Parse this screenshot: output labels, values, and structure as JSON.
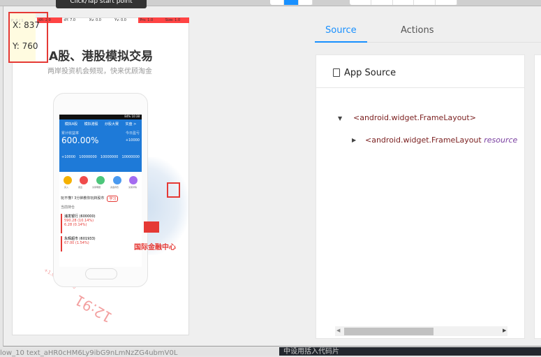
{
  "tooltip": "Click/Tap start point",
  "pointer": {
    "p": "P: 0 / 1",
    "dx": "dX: 2.0",
    "dy": "dY: 7.0",
    "xv": "Xv: 0.0",
    "yv": "Yv: 0.0",
    "prs": "Prs: 1.0",
    "size": "Size: 1.0"
  },
  "coords": {
    "x": "X: 837",
    "y": "Y: 760"
  },
  "screenshot": {
    "title": "A股、港股模拟交易",
    "subtitle": "两岸投资机会频现，快来优顾淘金",
    "phone": {
      "status": "84% 10:38",
      "tabs": [
        "模拟A股",
        "模拟港股",
        "炒股大赛",
        "实盘 >"
      ],
      "rate_label": "累计收益率",
      "rate": "600.00%",
      "today_label": "今日盈亏",
      "today": "+10000",
      "stats": [
        "+10000",
        "10000000",
        "10000000",
        "10000000"
      ],
      "icons": [
        "买入",
        "卖出",
        "交易明细",
        "资金持仓",
        "交易详情"
      ],
      "notice": "玩不懂? 3分钟教你玩转股市",
      "notice_btn": "学习",
      "section": "当前持仓",
      "stocks": [
        {
          "name": "浦发银行 (600000)",
          "price": "590.28 (10.14%)",
          "pct": "6.28 (0.14%)"
        },
        {
          "name": "永辉超市 (601933)",
          "price": "67.00 (1.54%)"
        }
      ]
    },
    "hk_label": "国际金融中心",
    "bg_big": "12:91",
    "bg_small": "+1.00% +0.10"
  },
  "tabs": {
    "source": "Source",
    "actions": "Actions"
  },
  "app_source": {
    "title": "App Source",
    "nodes": [
      {
        "tag": "<android.widget.FrameLayout>"
      },
      {
        "tag": "<android.widget.FrameLayout",
        "attr": "resource"
      }
    ]
  },
  "below": {
    "text": "low_10 text_aHR0cHM6Ly9ibG9nLmNzZG4ubmV0L",
    "editor": "中设用括入代码片"
  },
  "colors": {
    "accent": "#1890ff",
    "highlight": "#e53935"
  }
}
